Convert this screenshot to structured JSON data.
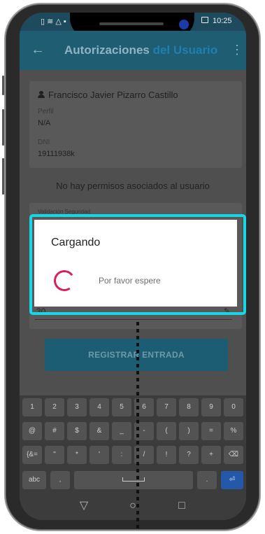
{
  "status_bar": {
    "left_icons": "▯ ≋ △ ▪",
    "time": "10:25"
  },
  "app_bar": {
    "title_main": "Autorizaciones",
    "title_accent": " del Usuario"
  },
  "user_card": {
    "name": "Francisco Javier Pizarro Castillo",
    "perfil_label": "Perfil",
    "perfil_value": "N/A",
    "dni_label": "DNI",
    "dni_value": "19111938k"
  },
  "no_permissions": "No hay permisos asociados al usuario",
  "security_label": "Validación Seguridad",
  "field_value": "30",
  "register_button": "REGISTRAR ENTRADA",
  "dialog": {
    "title": "Cargando",
    "message": "Por favor espere"
  },
  "keyboard": {
    "row1": [
      "1",
      "2",
      "3",
      "4",
      "5",
      "6",
      "7",
      "8",
      "9",
      "0"
    ],
    "row2": [
      "@",
      "#",
      "$",
      "&",
      "_",
      "-",
      "(",
      ")",
      "=",
      "%"
    ],
    "row3": [
      "{&=",
      "\"",
      "*",
      "'",
      ":",
      "/",
      "!",
      "?",
      "+",
      "⌫"
    ],
    "abc": "abc",
    "comma": ",",
    "period": ".",
    "enter": "⏎"
  },
  "nav": {
    "back": "▽",
    "home": "○",
    "recents": "□"
  },
  "colors": {
    "accent": "#17d6e6",
    "spinner": "#d81e5b",
    "appbar": "#1f5d72"
  }
}
